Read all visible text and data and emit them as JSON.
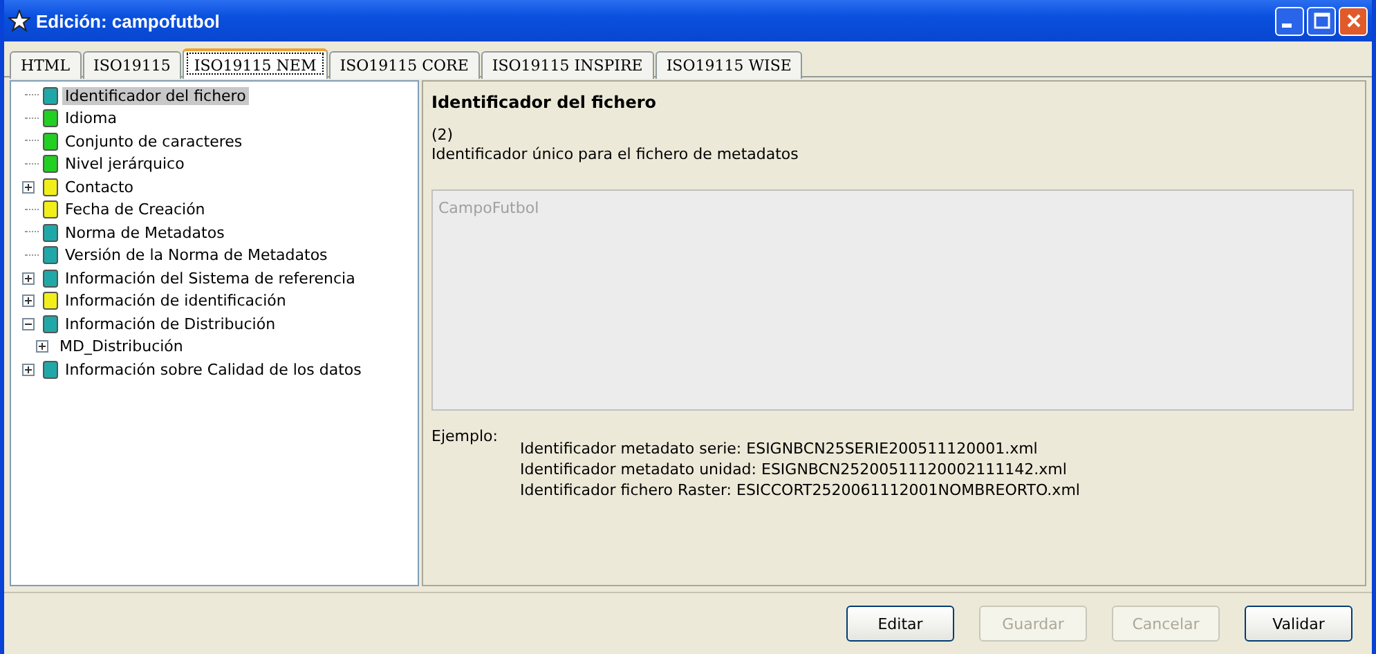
{
  "window": {
    "title": "Edición: campofutbol"
  },
  "tabs": [
    {
      "label": "HTML",
      "selected": false
    },
    {
      "label": "ISO19115",
      "selected": false
    },
    {
      "label": "ISO19115 NEM",
      "selected": true
    },
    {
      "label": "ISO19115 CORE",
      "selected": false
    },
    {
      "label": "ISO19115 INSPIRE",
      "selected": false
    },
    {
      "label": "ISO19115 WISE",
      "selected": false
    }
  ],
  "tree": [
    {
      "label": "Identificador del fichero",
      "color": "#20a8a8",
      "selected": true
    },
    {
      "label": "Idioma",
      "color": "#22d022",
      "selected": false
    },
    {
      "label": "Conjunto de caracteres",
      "color": "#22d022",
      "selected": false
    },
    {
      "label": "Nivel jerárquico",
      "color": "#22d022",
      "selected": false
    },
    {
      "label": "Contacto",
      "color": "#f2ee1a",
      "selected": false,
      "expanded": false
    },
    {
      "label": "Fecha de Creación",
      "color": "#f2ee1a",
      "selected": false
    },
    {
      "label": "Norma de Metadatos",
      "color": "#20a8a8",
      "selected": false
    },
    {
      "label": "Versión de la Norma de Metadatos",
      "color": "#20a8a8",
      "selected": false
    },
    {
      "label": "Información del Sistema de referencia",
      "color": "#20a8a8",
      "selected": false,
      "expanded": false
    },
    {
      "label": "Información de identificación",
      "color": "#f2ee1a",
      "selected": false,
      "expanded": false
    },
    {
      "label": "Información de Distribución",
      "color": "#20a8a8",
      "selected": false,
      "expanded": true,
      "children": [
        {
          "label": "MD_Distribución",
          "selected": false,
          "expanded": false
        }
      ]
    },
    {
      "label": "Información sobre Calidad de los datos",
      "color": "#20a8a8",
      "selected": false,
      "expanded": false
    }
  ],
  "detail": {
    "title": "Identificador del fichero",
    "number": "(2)",
    "description": "Identificador único para el fichero de metadatos",
    "value": "CampoFutbol",
    "example_label": "Ejemplo:",
    "examples": [
      "Identificador metadato serie: ESIGNBCN25SERIE200511120001.xml",
      "Identificador metadato unidad: ESIGNBCN25200511120002111142.xml",
      "Identificador fichero Raster: ESICCORT2520061112001NOMBREORTO.xml"
    ]
  },
  "buttons": [
    {
      "label": "Editar",
      "disabled": false
    },
    {
      "label": "Guardar",
      "disabled": true
    },
    {
      "label": "Cancelar",
      "disabled": true
    },
    {
      "label": "Validar",
      "disabled": false
    }
  ]
}
